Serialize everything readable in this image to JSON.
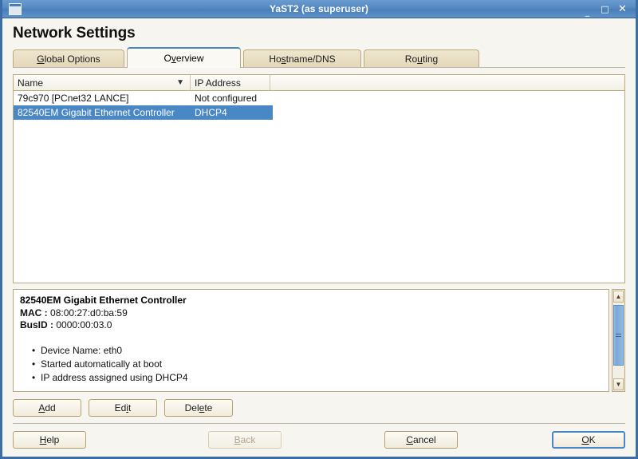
{
  "window": {
    "title": "YaST2 (as superuser)",
    "icon": "window-icon",
    "controls": {
      "minimize": "_",
      "maximize": "□",
      "close": "✕"
    }
  },
  "page": {
    "title": "Network Settings"
  },
  "tabs": [
    {
      "label": "Global Options",
      "pre": "",
      "acc": "G",
      "post": "lobal Options",
      "active": false
    },
    {
      "label": "Overview",
      "pre": "O",
      "acc": "v",
      "post": "erview",
      "active": true
    },
    {
      "label": "Hostname/DNS",
      "pre": "Ho",
      "acc": "s",
      "post": "tname/DNS",
      "active": false
    },
    {
      "label": "Routing",
      "pre": "Ro",
      "acc": "u",
      "post": "ting",
      "active": false
    }
  ],
  "table": {
    "columns": [
      "Name",
      "IP Address"
    ],
    "sort_icon": "chevron-down-icon",
    "rows": [
      {
        "name": "79c970 [PCnet32 LANCE]",
        "ip": "Not configured",
        "selected": false
      },
      {
        "name": "82540EM Gigabit Ethernet Controller",
        "ip": "DHCP4",
        "selected": true
      }
    ]
  },
  "detail": {
    "title": "82540EM Gigabit Ethernet Controller",
    "mac_label": "MAC :",
    "mac_value": "08:00:27:d0:ba:59",
    "busid_label": "BusID :",
    "busid_value": "0000:00:03.0",
    "bullets": [
      "Device Name: eth0",
      "Started automatically at boot",
      "IP address assigned using DHCP4"
    ],
    "scrollbar": {
      "up_arrow": "▲",
      "down_arrow": "▼"
    }
  },
  "tool_buttons": [
    {
      "label": "Add",
      "pre": "",
      "acc": "A",
      "post": "dd"
    },
    {
      "label": "Edit",
      "pre": "Ed",
      "acc": "i",
      "post": "t"
    },
    {
      "label": "Delete",
      "pre": "Del",
      "acc": "e",
      "post": "te"
    }
  ],
  "dialog_buttons": {
    "help": {
      "label": "Help",
      "pre": "",
      "acc": "H",
      "post": "elp",
      "enabled": true,
      "default": false
    },
    "back": {
      "label": "Back",
      "pre": "",
      "acc": "B",
      "post": "ack",
      "enabled": false,
      "default": false
    },
    "cancel": {
      "label": "Cancel",
      "pre": "",
      "acc": "C",
      "post": "ancel",
      "enabled": true,
      "default": false
    },
    "ok": {
      "label": "OK",
      "pre": "",
      "acc": "O",
      "post": "K",
      "enabled": true,
      "default": true
    }
  },
  "colors": {
    "titlebar_blue": "#5589c3",
    "selection_blue": "#4a87c5",
    "tab_tan": "#e4d7b9",
    "border_tan": "#b9a87e",
    "background": "#f7f5ef"
  }
}
